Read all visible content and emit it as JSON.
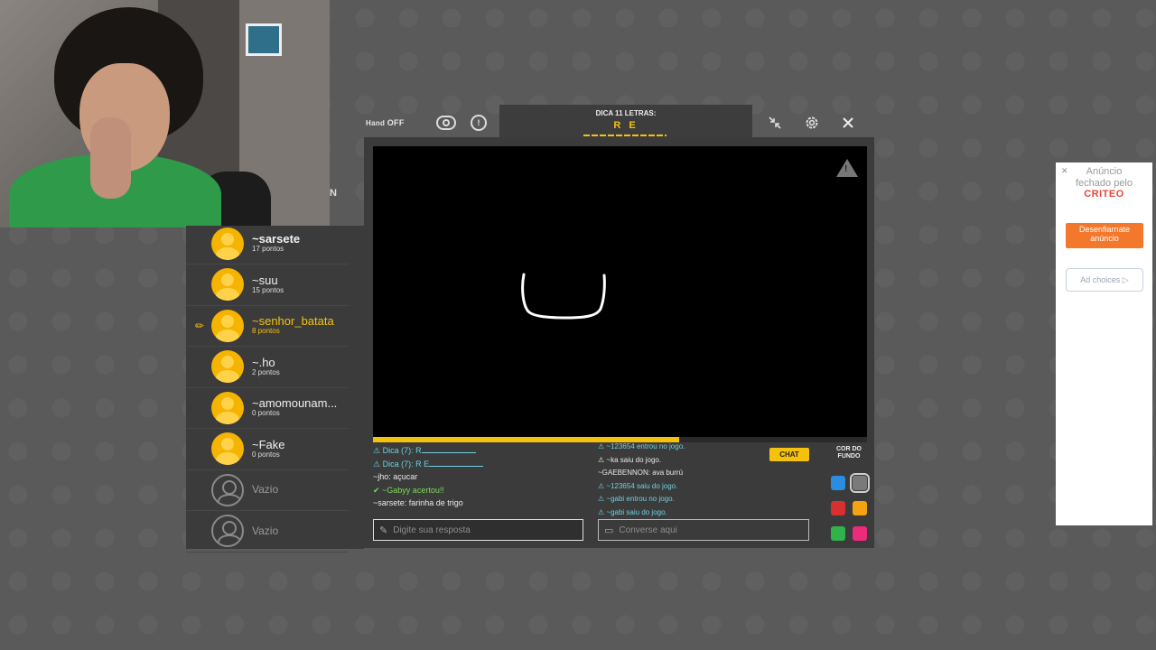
{
  "topbar": {
    "hand_label": "Hand",
    "hand_state": "OFF",
    "hint_title": "DICA 11 LETRAS:",
    "hint_letters": "R E"
  },
  "players": [
    {
      "name": "~sarsete",
      "points": "17 pontos",
      "state": "player"
    },
    {
      "name": "~suu",
      "points": "15 pontos",
      "state": "player"
    },
    {
      "name": "~senhor_batata",
      "points": "8 pontos",
      "state": "drawing"
    },
    {
      "name": "~.ho",
      "points": "2 pontos",
      "state": "player"
    },
    {
      "name": "~amomounam...",
      "points": "0 pontos",
      "state": "player"
    },
    {
      "name": "~Fake",
      "points": "0 pontos",
      "state": "player"
    },
    {
      "name": "Vazio",
      "points": "",
      "state": "empty"
    },
    {
      "name": "Vazio",
      "points": "",
      "state": "empty"
    }
  ],
  "side_letter": "N",
  "progress_fraction": 0.62,
  "answers": {
    "messages": [
      {
        "text": "⚠ Dica (7): R",
        "color": "cyan",
        "blank": true
      },
      {
        "text": "⚠ Dica (7): R E",
        "color": "cyan",
        "blank": true
      },
      {
        "text": "~jho: açucar",
        "color": "white",
        "blank": false
      },
      {
        "text": "✔ ~Gabyy acertou!!",
        "color": "green",
        "blank": false
      },
      {
        "text": "~sarsete: farinha de trigo",
        "color": "white",
        "blank": false
      }
    ],
    "placeholder": "Digite sua resposta"
  },
  "chat": {
    "button_label": "CHAT",
    "messages": [
      {
        "text": "⚠ ~123654 entrou no jogo.",
        "color": "cyan"
      },
      {
        "text": "⚠ ~ka saiu do jogo.",
        "color": "white"
      },
      {
        "text": "~GAEBENNON: ava burrú",
        "color": "white"
      },
      {
        "text": "⚠ ~123654 saiu do jogo.",
        "color": "cyan"
      },
      {
        "text": "⚠ ~gabi entrou no jogo.",
        "color": "cyan"
      },
      {
        "text": "⚠ ~gabi saiu do jogo.",
        "color": "cyan"
      }
    ],
    "placeholder": "Converse aqui"
  },
  "colors": {
    "title": "COR DO FUNDO",
    "swatches": [
      "#2a8de0",
      "#7a7a7a",
      "#d8302f",
      "#f5a310",
      "#2fb34a",
      "#ee2a7b"
    ],
    "selected_index": 1
  },
  "ad": {
    "close": "✕",
    "line1": "Anúncio",
    "line2": "fechado pelo",
    "brand": "CRITEO",
    "button": "Desenfiarnate anúncio",
    "choices": "Ad choices ▷"
  }
}
